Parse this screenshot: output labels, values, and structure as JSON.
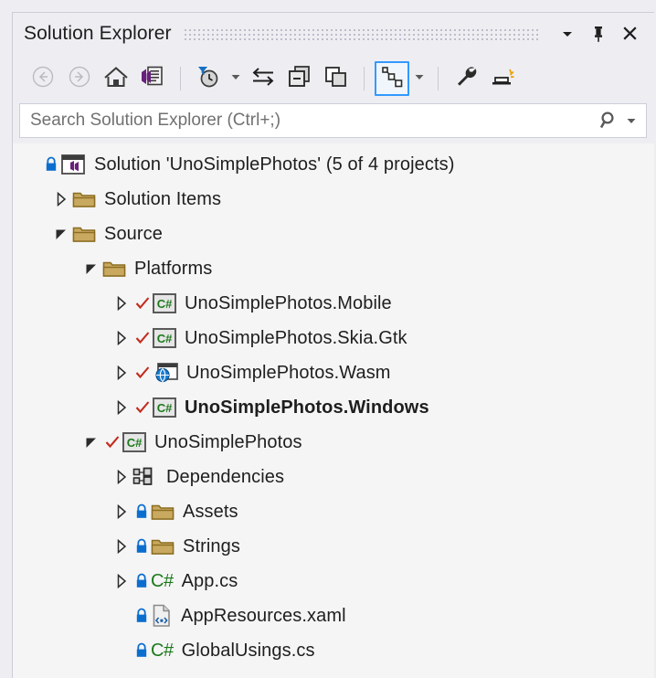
{
  "window": {
    "title": "Solution Explorer",
    "buttons": [
      {
        "name": "window-menu-dropdown",
        "icon": "chevron-down-icon"
      },
      {
        "name": "pin-button",
        "icon": "pin-icon"
      },
      {
        "name": "close-button",
        "icon": "close-icon"
      }
    ]
  },
  "toolbar": {
    "items": [
      {
        "name": "back-button",
        "icon": "arrow-left-circle-icon",
        "label": "Back",
        "state": "disabled"
      },
      {
        "name": "forward-button",
        "icon": "arrow-right-circle-icon",
        "label": "Forward",
        "state": "disabled"
      },
      {
        "name": "home-button",
        "icon": "home-icon",
        "label": "Home",
        "state": "enabled"
      },
      {
        "name": "pending-changes-button",
        "icon": "vs-document-icon",
        "label": "Solution Explorer Home",
        "state": "enabled"
      },
      {
        "name": "separator-1",
        "icon": "separator",
        "label": "",
        "state": "static"
      },
      {
        "name": "pending-changes-filter-button",
        "icon": "clock-filter-icon",
        "label": "Pending Changes Filter",
        "state": "enabled"
      },
      {
        "name": "pending-changes-filter-dropdown",
        "icon": "caret-down-icon",
        "label": "",
        "state": "enabled"
      },
      {
        "name": "sync-with-active-document-button",
        "icon": "sync-arrows-icon",
        "label": "Sync with Active Document",
        "state": "enabled"
      },
      {
        "name": "collapse-all-button",
        "icon": "collapse-all-icon",
        "label": "Collapse All",
        "state": "enabled"
      },
      {
        "name": "show-all-files-button",
        "icon": "show-all-files-icon",
        "label": "Show All Files",
        "state": "enabled"
      },
      {
        "name": "separator-2",
        "icon": "separator",
        "label": "",
        "state": "static"
      },
      {
        "name": "view-class-diagram-button",
        "icon": "node-graph-icon",
        "label": "Preview Selected Items",
        "state": "selected"
      },
      {
        "name": "view-class-diagram-dropdown",
        "icon": "caret-down-icon",
        "label": "",
        "state": "enabled"
      },
      {
        "name": "separator-3",
        "icon": "separator",
        "label": "",
        "state": "static"
      },
      {
        "name": "properties-button",
        "icon": "wrench-icon",
        "label": "Properties",
        "state": "enabled"
      },
      {
        "name": "dark-mode-button",
        "icon": "sparkle-bar-icon",
        "label": "Preview",
        "state": "enabled"
      }
    ]
  },
  "search": {
    "placeholder": "Search Solution Explorer (Ctrl+;)",
    "value": "",
    "icon": "search-icon",
    "dropdown_icon": "caret-down-icon"
  },
  "tree": {
    "nodes": [
      {
        "name": "solution-node",
        "label": "Solution 'UnoSimplePhotos' (5 of 4 projects)",
        "indent": 0,
        "expander": "none",
        "lock": true,
        "check": false,
        "icon": "solution-icon",
        "bold": false
      },
      {
        "name": "tree-node-solution-items",
        "label": "Solution Items",
        "indent": 1,
        "expander": "collapsed",
        "lock": false,
        "check": false,
        "icon": "folder-icon",
        "bold": false
      },
      {
        "name": "tree-node-source",
        "label": "Source",
        "indent": 1,
        "expander": "expanded",
        "lock": false,
        "check": false,
        "icon": "folder-icon",
        "bold": false
      },
      {
        "name": "tree-node-platforms",
        "label": "Platforms",
        "indent": 2,
        "expander": "expanded",
        "lock": false,
        "check": false,
        "icon": "folder-icon",
        "bold": false
      },
      {
        "name": "tree-node-unosimplephotos-mobile",
        "label": "UnoSimplePhotos.Mobile",
        "indent": 3,
        "expander": "collapsed",
        "lock": false,
        "check": true,
        "icon": "csharp-project-icon",
        "bold": false
      },
      {
        "name": "tree-node-unosimplephotos-skia-gtk",
        "label": "UnoSimplePhotos.Skia.Gtk",
        "indent": 3,
        "expander": "collapsed",
        "lock": false,
        "check": true,
        "icon": "csharp-project-icon",
        "bold": false
      },
      {
        "name": "tree-node-unosimplephotos-wasm",
        "label": "UnoSimplePhotos.Wasm",
        "indent": 3,
        "expander": "collapsed",
        "lock": false,
        "check": true,
        "icon": "wasm-project-icon",
        "bold": false
      },
      {
        "name": "tree-node-unosimplephotos-windows",
        "label": "UnoSimplePhotos.Windows",
        "indent": 3,
        "expander": "collapsed",
        "lock": false,
        "check": true,
        "icon": "csharp-project-icon",
        "bold": true
      },
      {
        "name": "tree-node-unosimplephotos",
        "label": "UnoSimplePhotos",
        "indent": 2,
        "expander": "expanded",
        "lock": false,
        "check": true,
        "icon": "csharp-project-icon",
        "bold": false
      },
      {
        "name": "tree-node-dependencies",
        "label": "Dependencies",
        "indent": 3,
        "expander": "collapsed",
        "lock": false,
        "check": false,
        "icon": "dependencies-icon",
        "bold": false
      },
      {
        "name": "tree-node-assets",
        "label": "Assets",
        "indent": 3,
        "expander": "collapsed",
        "lock": true,
        "check": false,
        "icon": "folder-icon",
        "bold": false
      },
      {
        "name": "tree-node-strings",
        "label": "Strings",
        "indent": 3,
        "expander": "collapsed",
        "lock": true,
        "check": false,
        "icon": "folder-icon",
        "bold": false
      },
      {
        "name": "tree-node-app-cs",
        "label": "App.cs",
        "indent": 3,
        "expander": "collapsed",
        "lock": true,
        "check": false,
        "icon": "csharp-file-icon",
        "bold": false
      },
      {
        "name": "tree-node-appresources-xaml",
        "label": "AppResources.xaml",
        "indent": 3,
        "expander": "none",
        "lock": true,
        "check": false,
        "icon": "xaml-file-icon",
        "bold": false
      },
      {
        "name": "tree-node-globalusings-cs",
        "label": "GlobalUsings.cs",
        "indent": 3,
        "expander": "none",
        "lock": true,
        "check": false,
        "icon": "csharp-file-icon",
        "bold": false
      }
    ]
  },
  "colors": {
    "accent": "#3399ff",
    "folder": "#c8a95f",
    "csharp_green": "#1c7a1c",
    "check_red": "#c42b1c",
    "lock_blue": "#0b6ecf",
    "vs_purple": "#68217a",
    "panel_bg": "#f5f5f5",
    "chrome_bg": "#eeeef2"
  }
}
